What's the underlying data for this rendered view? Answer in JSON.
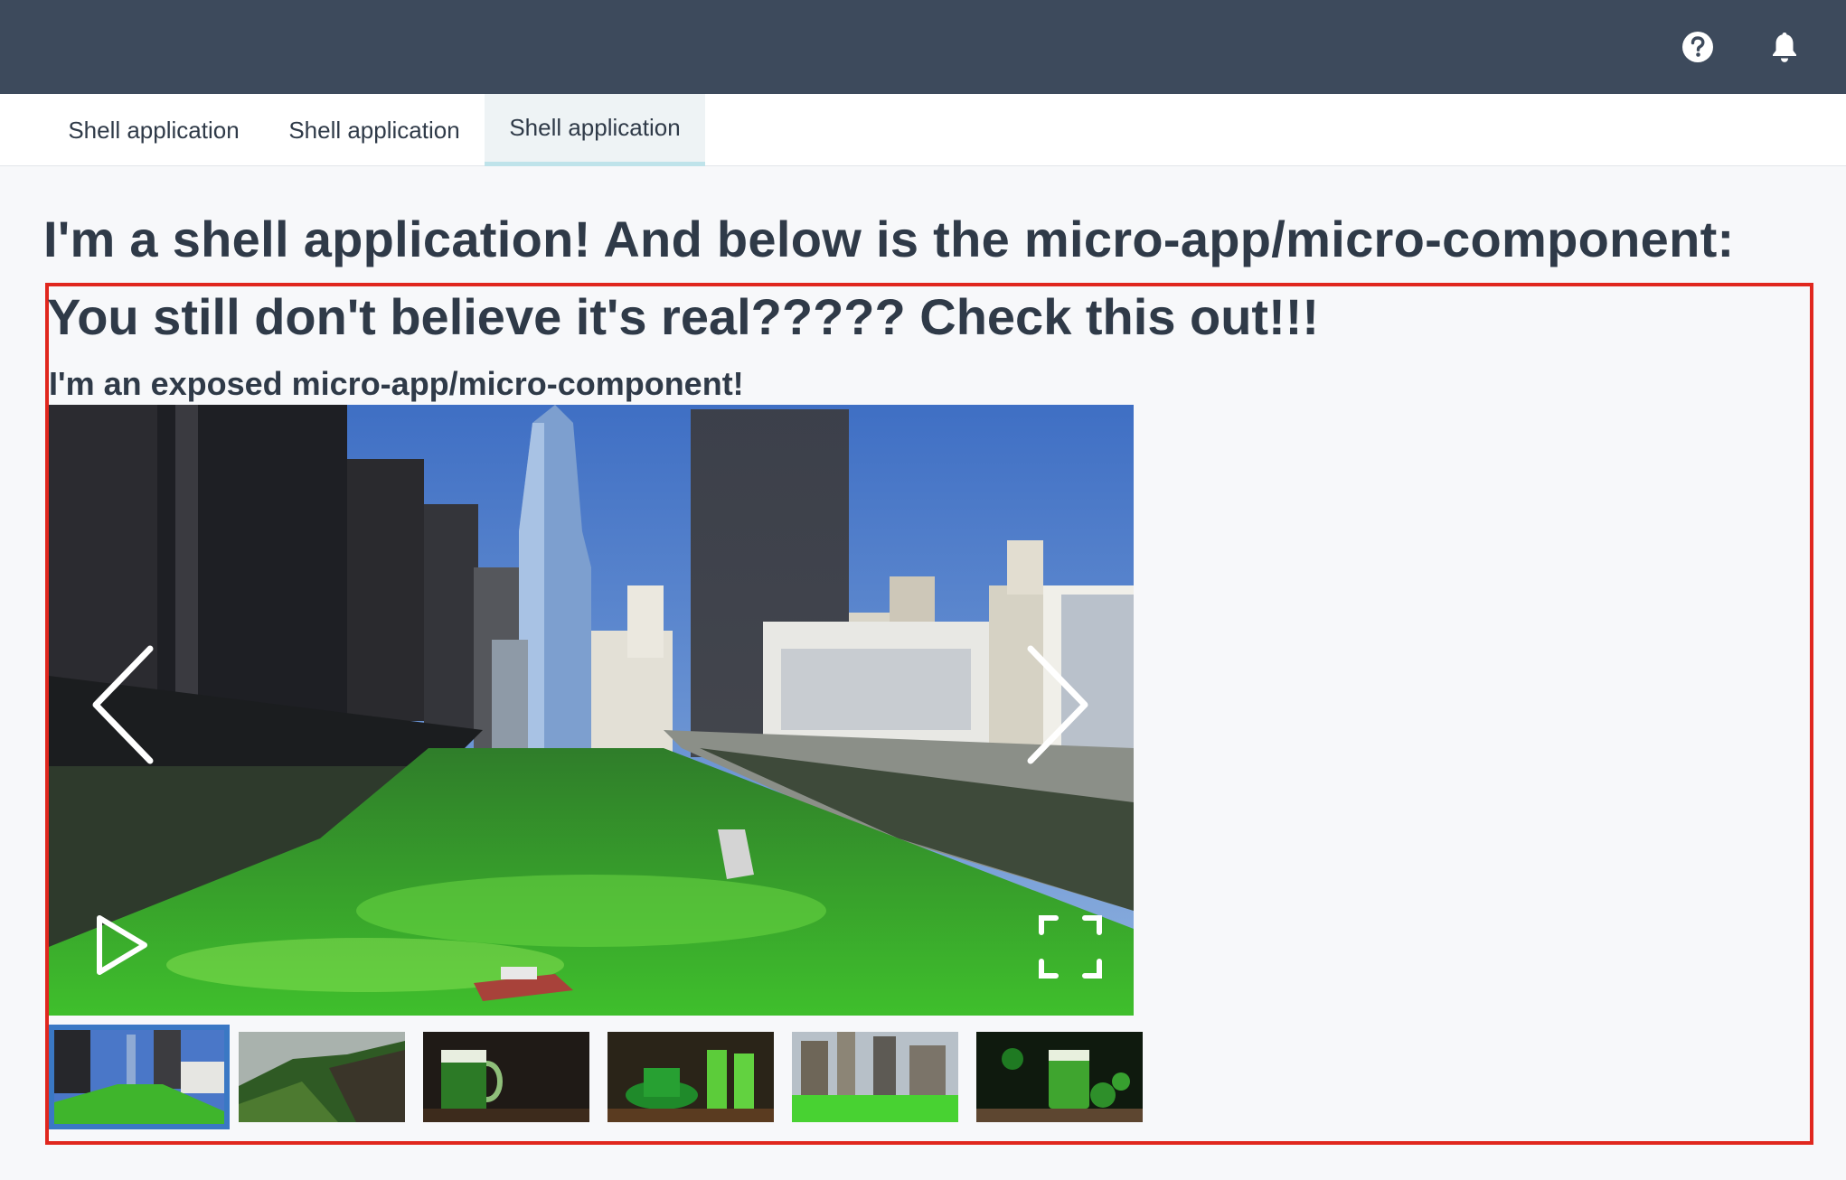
{
  "header": {
    "help_icon": "help-circle-icon",
    "notifications_icon": "bell-icon",
    "background_color": "#3d4a5c"
  },
  "tabs": [
    {
      "label": "Shell application",
      "active": false
    },
    {
      "label": "Shell application",
      "active": false
    },
    {
      "label": "Shell application",
      "active": true
    }
  ],
  "page": {
    "title": "I'm a shell application! And below is the micro-app/micro-component:"
  },
  "micro_app": {
    "border_color": "#e0271e",
    "title": "You still don't believe it's real????? Check this out!!!",
    "subtitle": "I'm an exposed micro-app/micro-component!",
    "gallery": {
      "prev_icon": "chevron-left-icon",
      "next_icon": "chevron-right-icon",
      "play_icon": "play-icon",
      "fullscreen_icon": "fullscreen-icon",
      "active_index": 0,
      "thumbnails": [
        {
          "subject": "green river city skyline"
        },
        {
          "subject": "green hills landscape"
        },
        {
          "subject": "green beer mug"
        },
        {
          "subject": "green hat and beer glasses"
        },
        {
          "subject": "green river downtown"
        },
        {
          "subject": "green beer with shamrocks"
        }
      ]
    }
  }
}
